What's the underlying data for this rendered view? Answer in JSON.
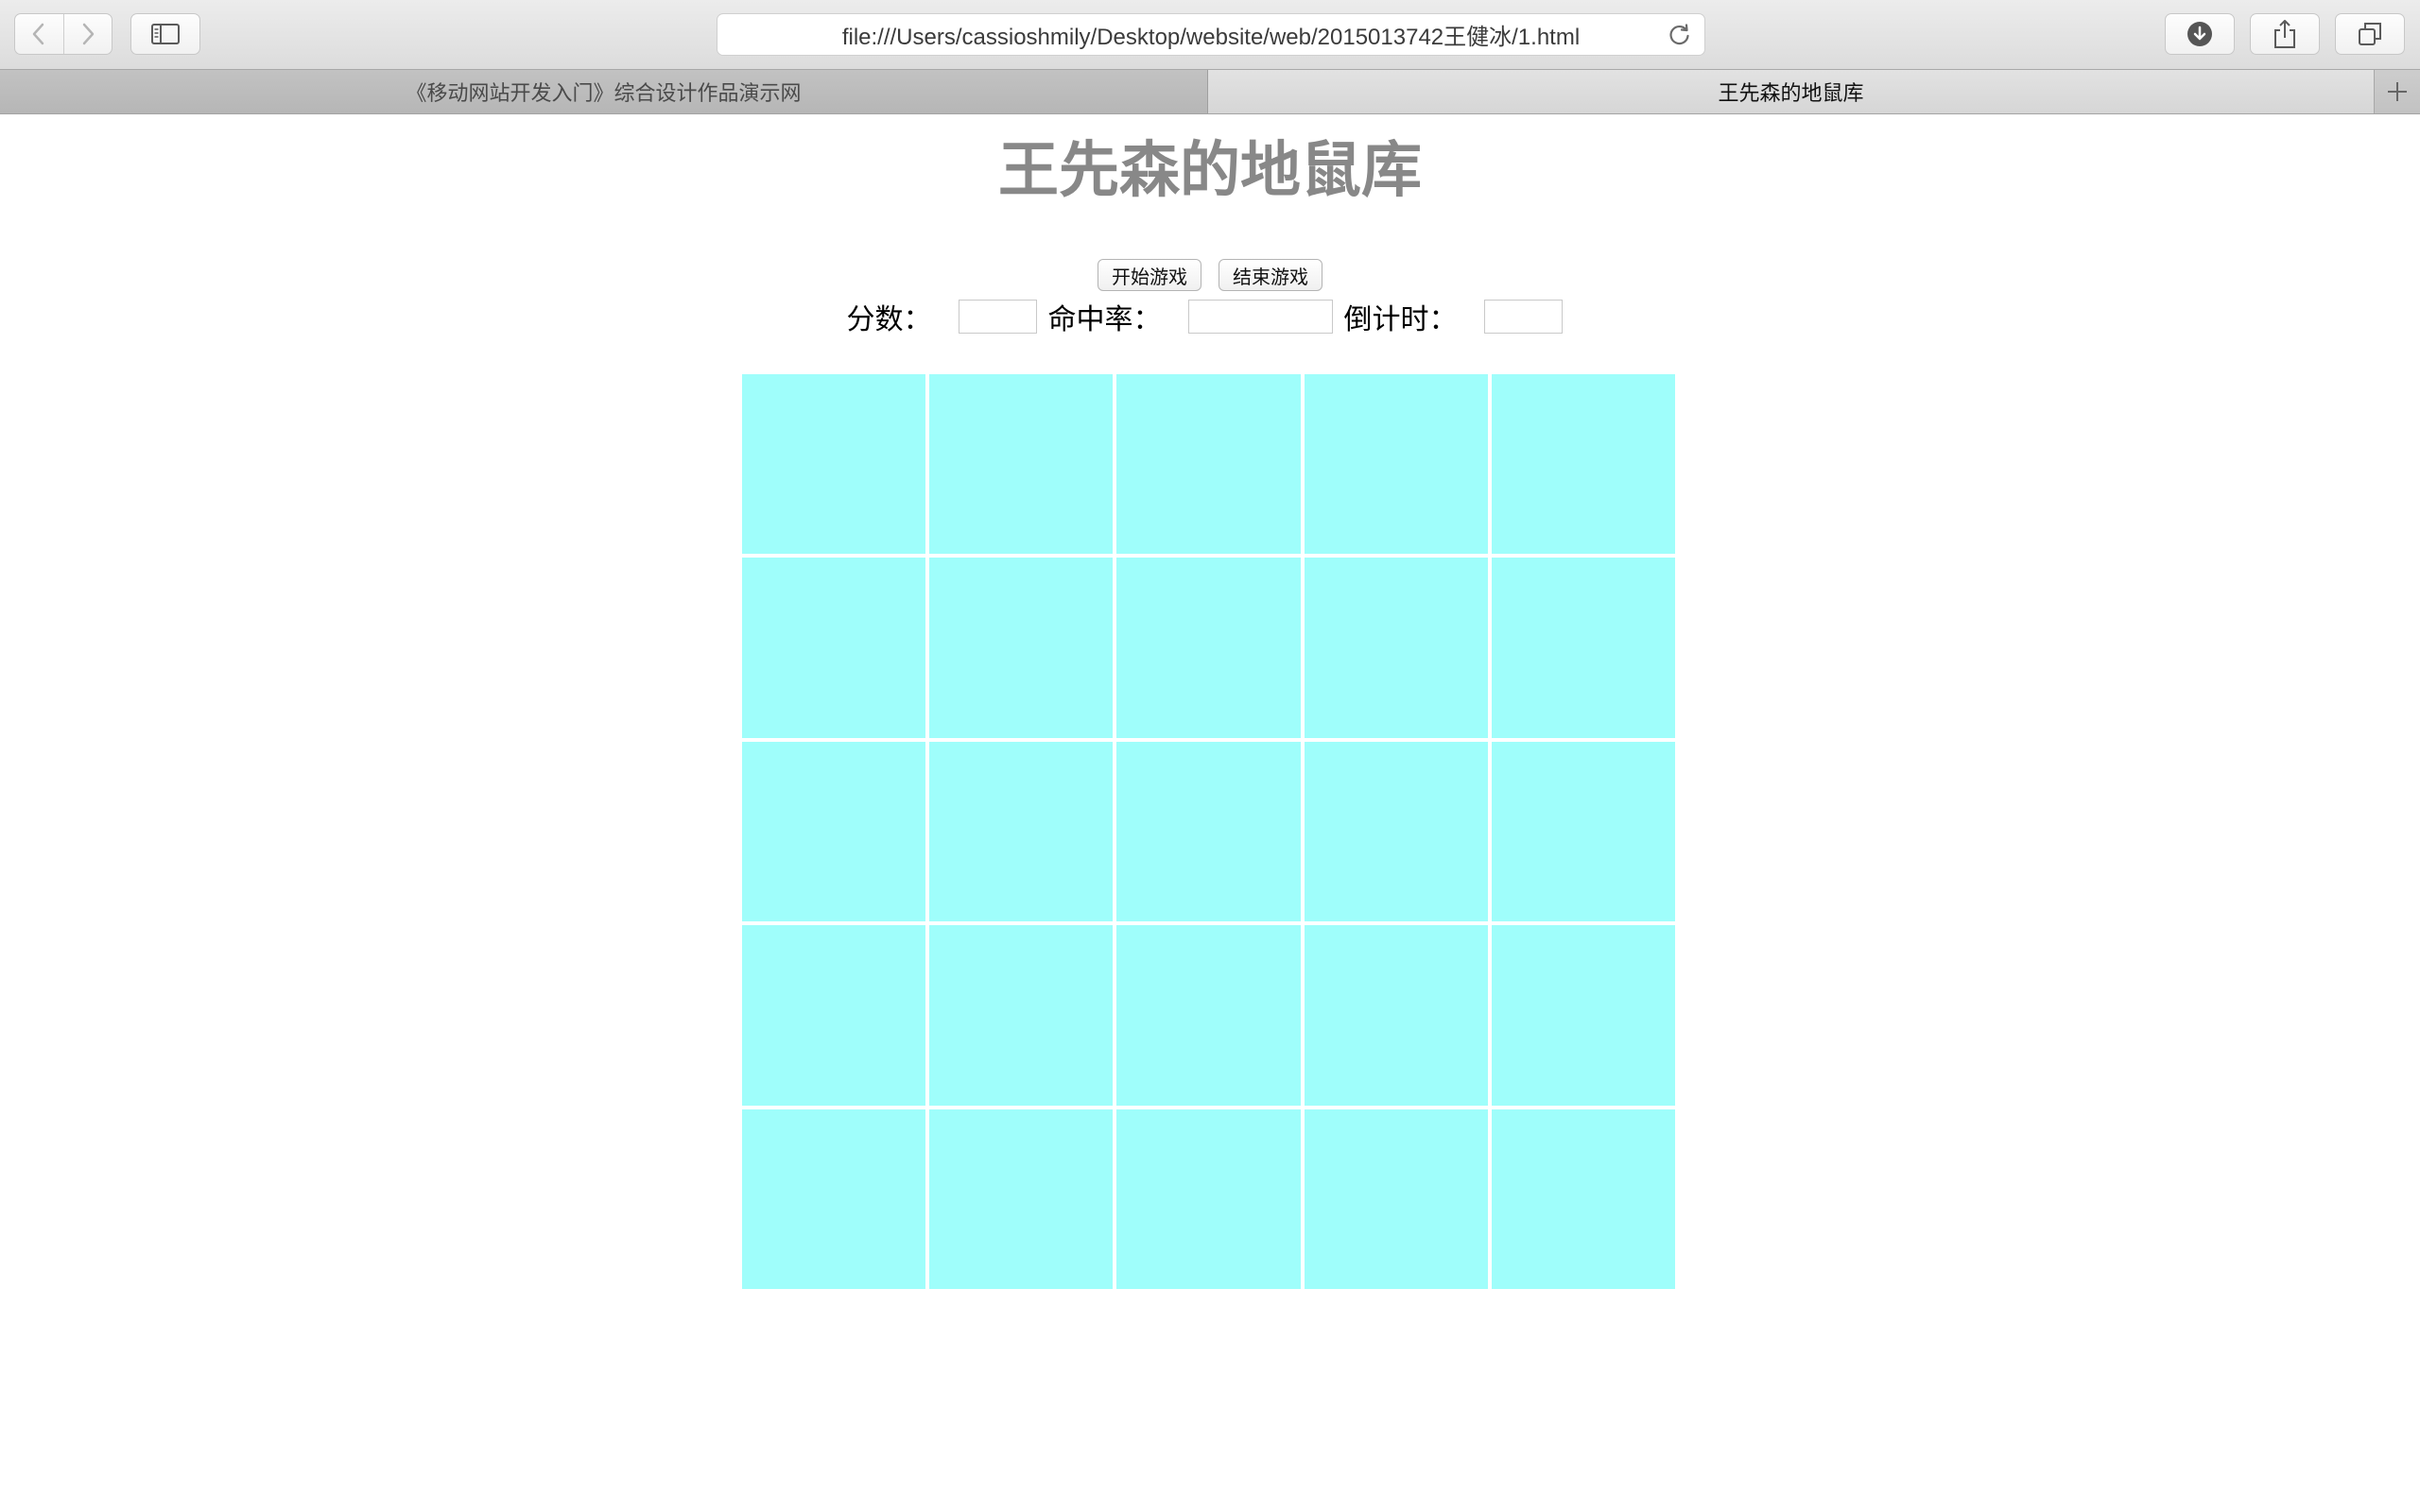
{
  "browser": {
    "url": "file:///Users/cassioshmily/Desktop/website/web/2015013742王健冰/1.html",
    "tabs": [
      {
        "label": "《移动网站开发入门》综合设计作品演示网",
        "active": false
      },
      {
        "label": "王先森的地鼠库",
        "active": true
      }
    ],
    "icons": {
      "back": "chevron-left-icon",
      "forward": "chevron-right-icon",
      "sidebar": "sidebar-icon",
      "reload": "reload-icon",
      "downloads": "download-icon",
      "share": "share-icon",
      "tabs_overview": "tabs-overview-icon",
      "new_tab": "plus-icon"
    }
  },
  "page": {
    "title": "王先森的地鼠库",
    "buttons": {
      "start": "开始游戏",
      "end": "结束游戏"
    },
    "stats": {
      "score_label": "分数：",
      "score_value": "",
      "hit_rate_label": "命中率：",
      "hit_rate_value": "",
      "countdown_label": "倒计时：",
      "countdown_value": ""
    },
    "grid": {
      "rows": 5,
      "columns": 5,
      "cell_color": "#9ffefb"
    }
  },
  "colors": {
    "title": "#888888",
    "cell": "#9ffefb",
    "background": "#ffffff"
  }
}
